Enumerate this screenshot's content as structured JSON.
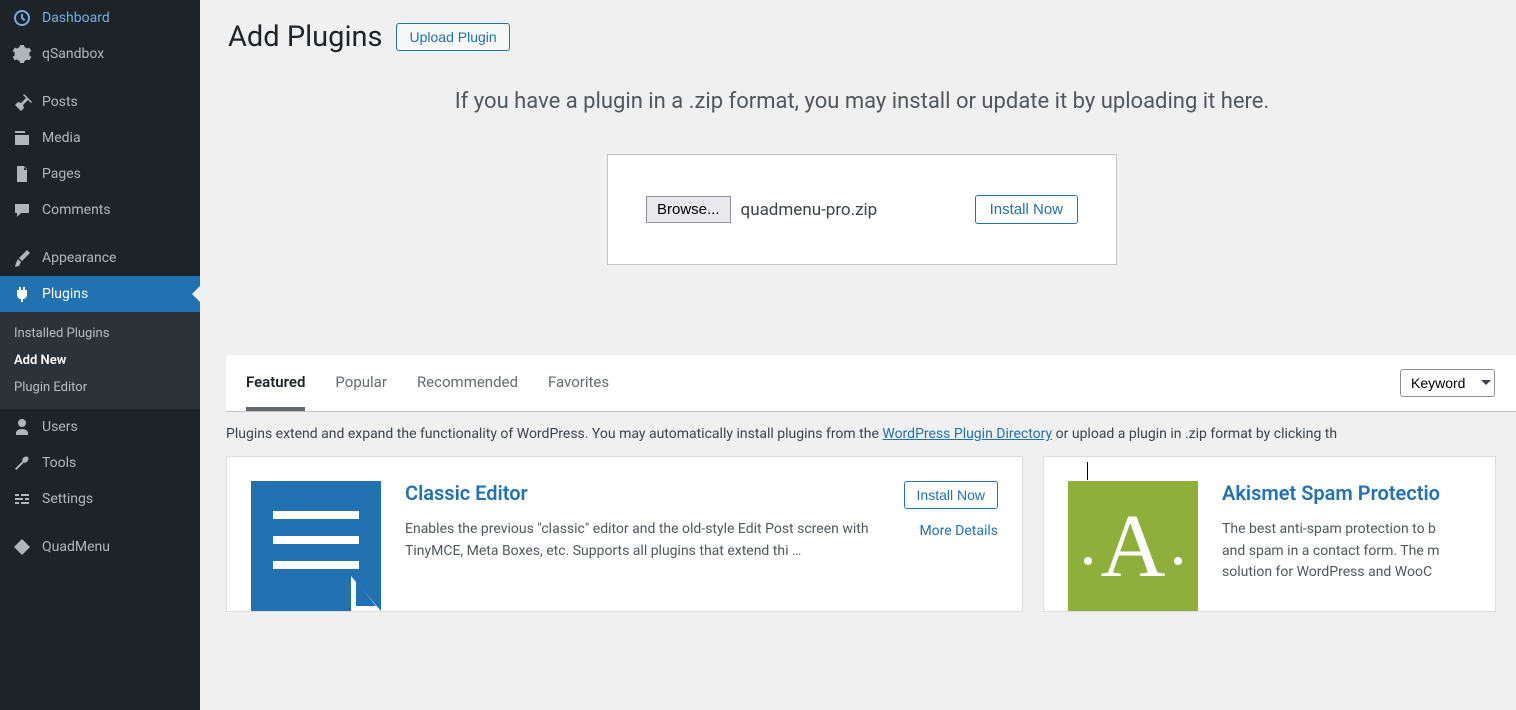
{
  "sidebar": {
    "items": [
      {
        "label": "Dashboard"
      },
      {
        "label": "qSandbox"
      },
      {
        "label": "Posts"
      },
      {
        "label": "Media"
      },
      {
        "label": "Pages"
      },
      {
        "label": "Comments"
      },
      {
        "label": "Appearance"
      },
      {
        "label": "Plugins"
      },
      {
        "label": "Users"
      },
      {
        "label": "Tools"
      },
      {
        "label": "Settings"
      },
      {
        "label": "QuadMenu"
      }
    ],
    "plugin_sub": {
      "installed": "Installed Plugins",
      "add_new": "Add New",
      "editor": "Plugin Editor"
    }
  },
  "header": {
    "title": "Add Plugins",
    "upload_btn": "Upload Plugin"
  },
  "upload": {
    "instruction": "If you have a plugin in a .zip format, you may install or update it by uploading it here.",
    "browse_btn": "Browse...",
    "file_name": "quadmenu-pro.zip",
    "install_btn": "Install Now"
  },
  "tabs": {
    "featured": "Featured",
    "popular": "Popular",
    "recommended": "Recommended",
    "favorites": "Favorites"
  },
  "filter": {
    "keyword": "Keyword"
  },
  "description": {
    "text_before": "Plugins extend and expand the functionality of WordPress. You may automatically install plugins from the ",
    "link": "WordPress Plugin Directory",
    "text_after": " or upload a plugin in .zip format by clicking th"
  },
  "cards": {
    "classic": {
      "title": "Classic Editor",
      "desc": "Enables the previous \"classic\" editor and the old-style Edit Post screen with TinyMCE, Meta Boxes, etc. Supports all plugins that extend thi …",
      "install": "Install Now",
      "more": "More Details"
    },
    "akismet": {
      "title": "Akismet Spam Protectio",
      "desc": "The best anti-spam protection to b and spam in a contact form. The m solution for WordPress and WooC"
    }
  }
}
